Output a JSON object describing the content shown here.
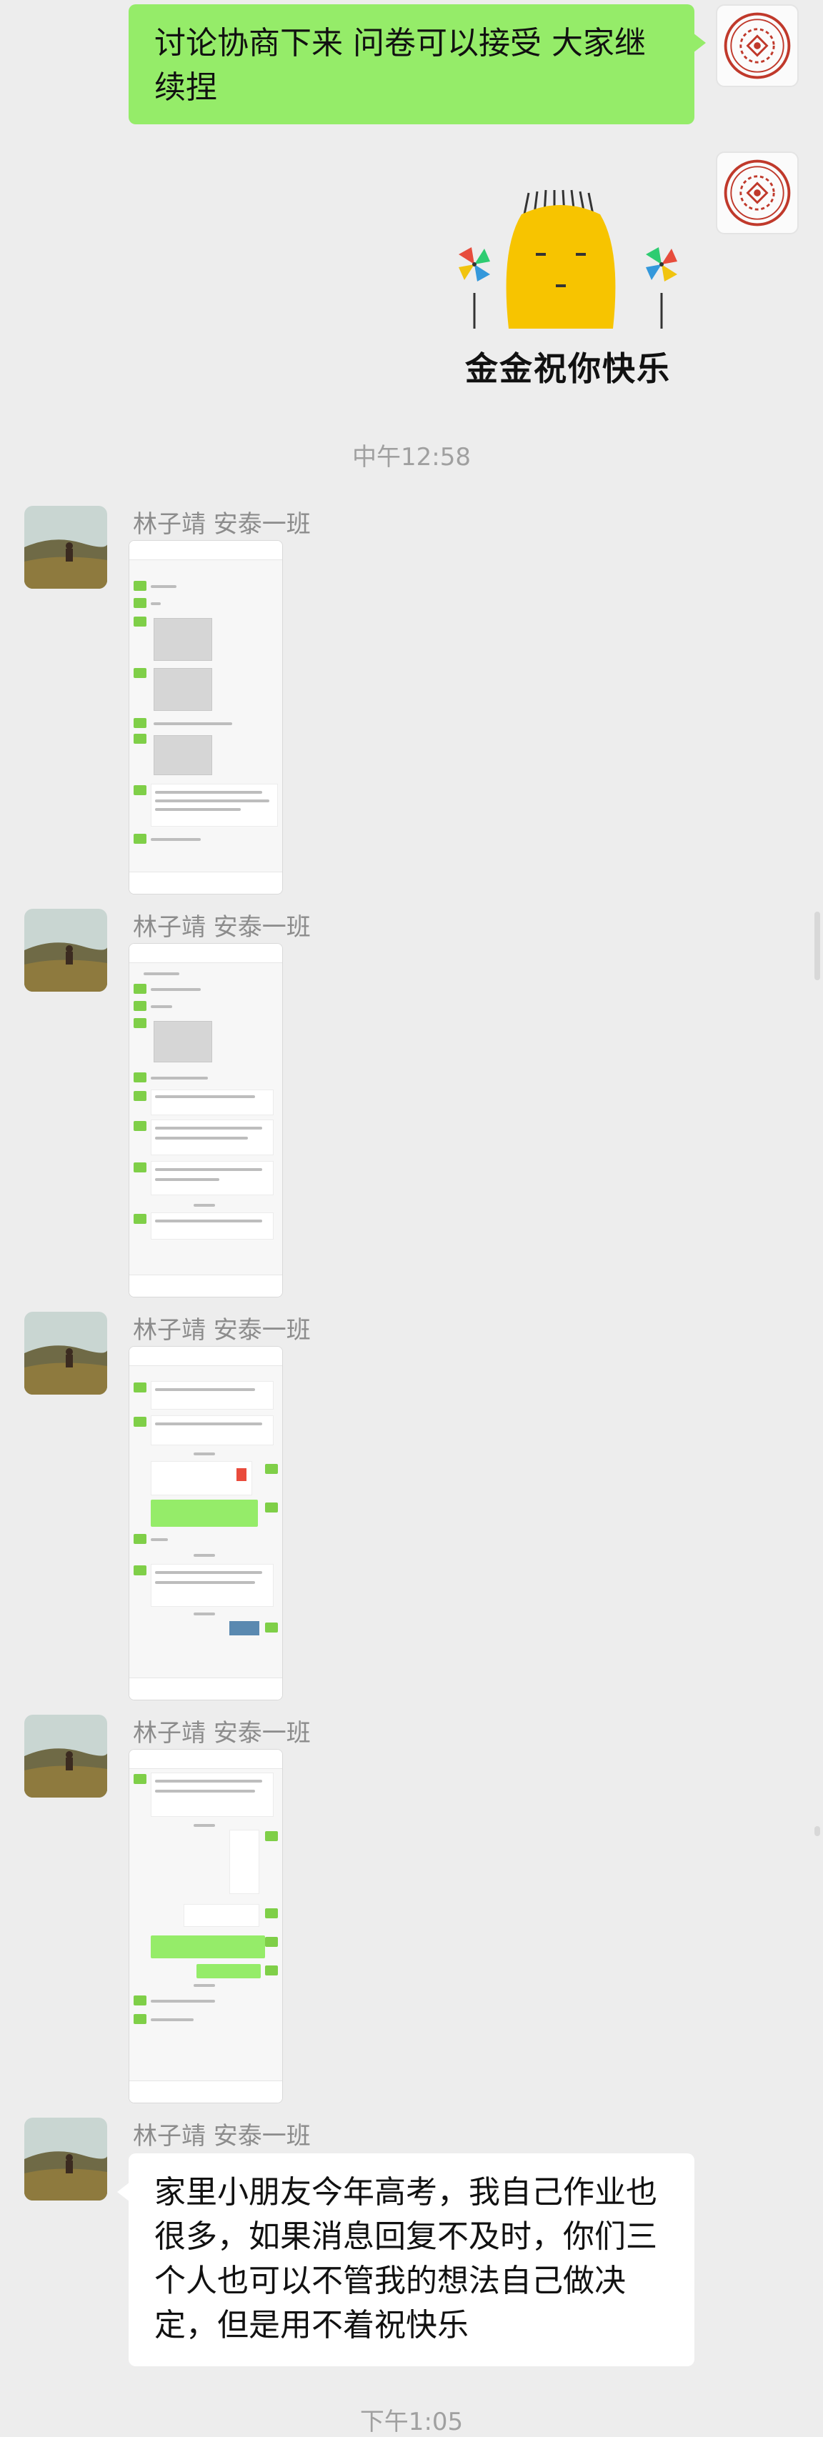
{
  "messages": {
    "self_text": "讨论协商下来 问卷可以接受 大家继续捏",
    "sticker_caption": "金金祝你快乐",
    "time_1": "中午12:58",
    "time_2": "下午1:05",
    "sender_name": "林子靖 安泰一班",
    "final_text": "家里小朋友今年高考，我自己作业也很多，如果消息回复不及时，你们三个人也可以不管我的想法自己做决定，但是用不着祝快乐"
  },
  "icons": {
    "self_avatar": "red-seal-avatar-icon",
    "contact_avatar": "landscape-photo-avatar-icon",
    "sticker": "yellow-blob-pinwheel-sticker-icon"
  },
  "colors": {
    "background": "#ededed",
    "sent_bubble": "#95ec69",
    "received_bubble": "#ffffff",
    "timestamp": "#a0a0a0",
    "sender_name": "#8c8c8c"
  }
}
